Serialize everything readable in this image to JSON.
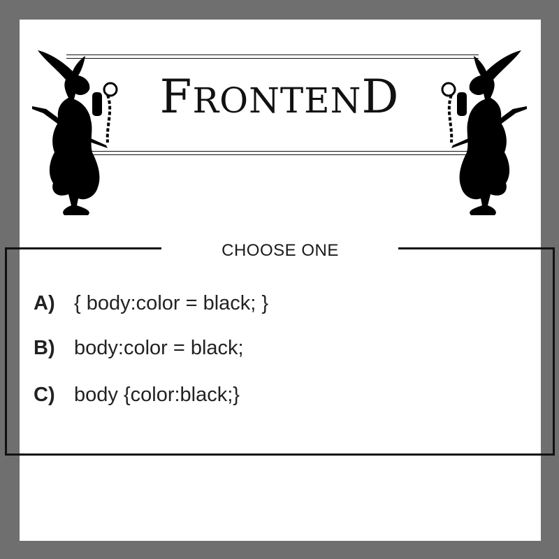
{
  "title": "Frontend",
  "title_display": {
    "f": "F",
    "ronten": "RONTEN",
    "d": "D"
  },
  "prompt": "CHOOSE ONE",
  "options": [
    {
      "letter": "A)",
      "text": "{ body:color = black; }"
    },
    {
      "letter": "B)",
      "text": "body:color = black;"
    },
    {
      "letter": "C)",
      "text": "body {color:black;}"
    }
  ],
  "colors": {
    "frame": "#6f6f6f",
    "background": "#ffffff",
    "ink": "#111111"
  },
  "decorations": [
    "rabbit-silhouette-left",
    "rabbit-silhouette-right"
  ]
}
